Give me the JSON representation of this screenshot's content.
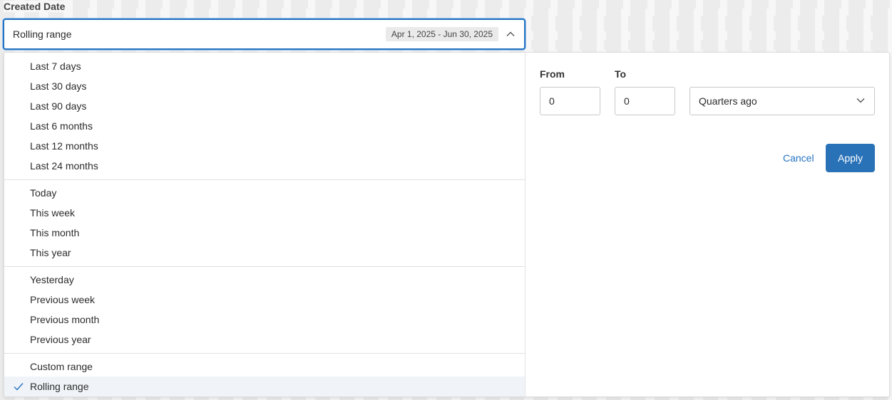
{
  "field": {
    "label": "Created Date",
    "selected_value": "Rolling range",
    "range_chip": "Apr 1, 2025 - Jun 30, 2025"
  },
  "options": {
    "groups": [
      [
        "Last 7 days",
        "Last 30 days",
        "Last 90 days",
        "Last 6 months",
        "Last 12 months",
        "Last 24 months"
      ],
      [
        "Today",
        "This week",
        "This month",
        "This year"
      ],
      [
        "Yesterday",
        "Previous week",
        "Previous month",
        "Previous year"
      ],
      [
        "Custom range",
        "Rolling range"
      ]
    ],
    "selected": "Rolling range"
  },
  "rolling": {
    "from_label": "From",
    "to_label": "To",
    "from_value": "0",
    "to_value": "0",
    "unit": "Quarters ago"
  },
  "actions": {
    "cancel": "Cancel",
    "apply": "Apply"
  },
  "colors": {
    "accent": "#2574c2",
    "apply_bg": "#2a72b8",
    "selected_row_bg": "#f0f4f8"
  },
  "icons": {
    "select_chevron": "chevron-up-icon",
    "unit_chevron": "chevron-down-icon",
    "selected_check": "check-icon"
  }
}
